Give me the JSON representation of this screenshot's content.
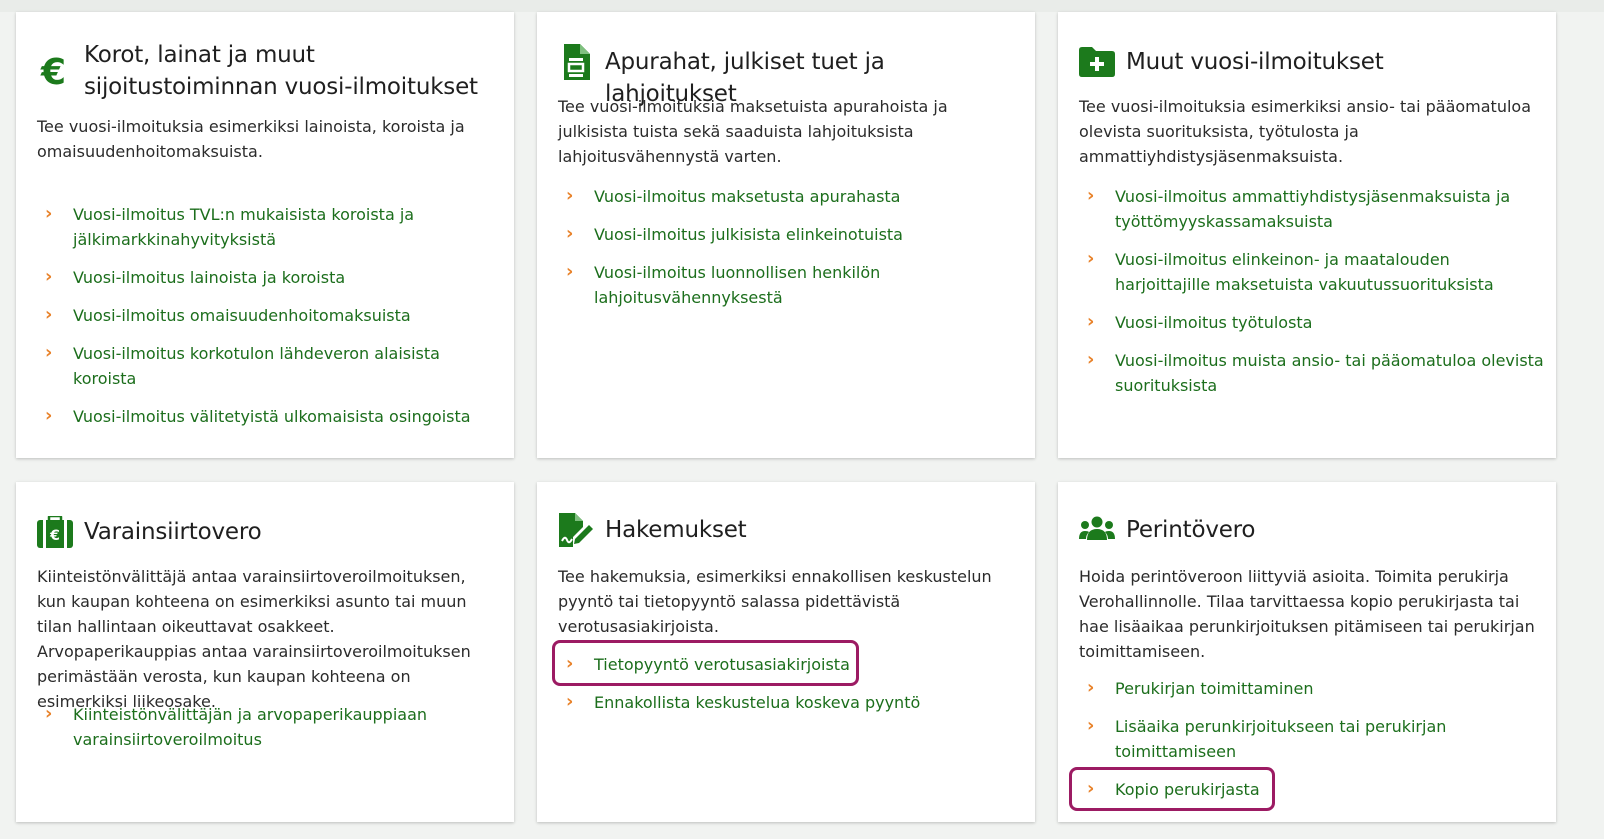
{
  "colors": {
    "accent_green": "#1c7a1c",
    "link_green": "#1c6e1c",
    "chevron": "#e8822a",
    "highlight": "#9c1b63"
  },
  "cards": [
    {
      "icon": "euro-icon",
      "title": "Korot, lainat ja muut sijoitustoiminnan vuosi-ilmoitukset",
      "title_lines": [
        "Korot, lainat ja muut",
        "sijoitustoiminnan vuosi-ilmoitukset"
      ],
      "description": "Tee vuosi-ilmoituksia esimerkiksi lainoista, koroista ja omaisuudenhoitomaksuista.",
      "links": [
        "Vuosi-ilmoitus TVL:n mukaisista koroista ja jälkimarkkinahyvityksistä",
        "Vuosi-ilmoitus lainoista ja koroista",
        "Vuosi-ilmoitus omaisuudenhoitomaksuista",
        "Vuosi-ilmoitus korkotulon lähdeveron alaisista koroista",
        "Vuosi-ilmoitus välitetyistä ulkomaisista osingoista"
      ]
    },
    {
      "icon": "document-form-icon",
      "title": "Apurahat, julkiset tuet ja lahjoitukset",
      "description": "Tee vuosi-ilmoituksia maksetuista apurahoista ja julkisista tuista sekä saaduista lahjoituksista lahjoitusvähennystä varten.",
      "links": [
        "Vuosi-ilmoitus maksetusta apurahasta",
        "Vuosi-ilmoitus julkisista elinkeinotuista",
        "Vuosi-ilmoitus luonnollisen henkilön lahjoitusvähennyksestä"
      ]
    },
    {
      "icon": "folder-plus-icon",
      "title": "Muut vuosi-ilmoitukset",
      "description": "Tee vuosi-ilmoituksia esimerkiksi ansio- tai pääomatuloa olevista suorituksista, työtulosta ja ammattiyhdistysjäsenmaksuista.",
      "links": [
        "Vuosi-ilmoitus ammattiyhdistysjäsenmaksuista ja työttömyyskassamaksuista",
        "Vuosi-ilmoitus elinkeinon- ja maatalouden harjoittajille maksetuista vakuutussuorituksista",
        "Vuosi-ilmoitus työtulosta",
        "Vuosi-ilmoitus muista ansio- tai pääomatuloa olevista suorituksista"
      ]
    },
    {
      "icon": "property-transfer-icon",
      "title": "Varainsiirtovero",
      "description": "Kiinteistönvälittäjä antaa varainsiirtoveroilmoituksen, kun kaupan kohteena on esimerkiksi asunto tai muun tilan hallintaan oikeuttavat osakkeet. Arvopaperikauppias antaa varainsiirtoveroilmoituksen perimästään verosta, kun kaupan kohteena on esimerkiksi liikeosake.",
      "links": [
        "Kiinteistönvälittäjän ja arvopaperikauppiaan varainsiirtoveroilmoitus"
      ]
    },
    {
      "icon": "signed-document-icon",
      "title": "Hakemukset",
      "description": "Tee hakemuksia, esimerkiksi ennakollisen keskustelun pyyntö tai tietopyyntö salassa pidettävistä verotusasiakirjoista.",
      "links": [
        "Tietopyyntö verotusasiakirjoista",
        "Ennakollista keskustelua koskeva pyyntö"
      ]
    },
    {
      "icon": "users-icon",
      "title": "Perintövero",
      "description": "Hoida perintöveroon liittyviä asioita. Toimita perukirja Verohallinnolle. Tilaa tarvittaessa kopio perukirjasta tai hae lisäaikaa perunkirjoituksen pitämiseen tai perukirjan toimittamiseen.",
      "links": [
        "Perukirjan toimittaminen",
        "Lisäaika perunkirjoitukseen tai perukirjan toimittamiseen",
        "Kopio perukirjasta"
      ]
    }
  ]
}
